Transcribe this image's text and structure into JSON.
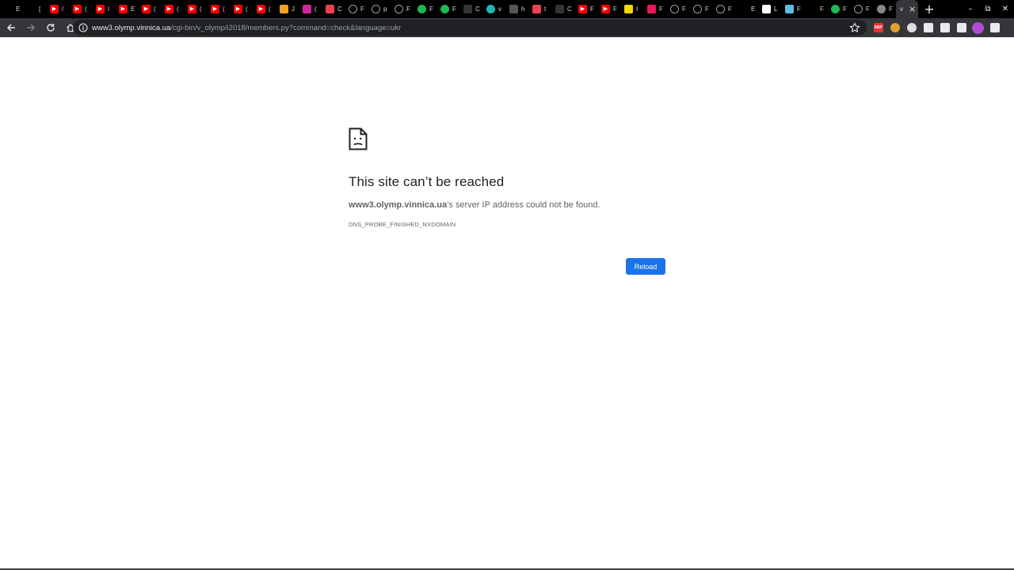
{
  "browser": {
    "tabs": [
      {
        "title": "E",
        "icon": "blank-icon",
        "color": "#000000"
      },
      {
        "title": "[",
        "icon": "blank-icon",
        "color": "#000000"
      },
      {
        "title": "/",
        "icon": "youtube-icon",
        "color": "#ff0000"
      },
      {
        "title": "(",
        "icon": "youtube-icon",
        "color": "#ff0000"
      },
      {
        "title": "I",
        "icon": "youtube-icon",
        "color": "#ff0000"
      },
      {
        "title": "E",
        "icon": "youtube-icon",
        "color": "#ff0000"
      },
      {
        "title": "(",
        "icon": "youtube-icon",
        "color": "#ff0000"
      },
      {
        "title": "(",
        "icon": "youtube-icon",
        "color": "#ff0000"
      },
      {
        "title": "(",
        "icon": "youtube-icon",
        "color": "#ff0000"
      },
      {
        "title": "(",
        "icon": "youtube-icon",
        "color": "#ff0000"
      },
      {
        "title": "(",
        "icon": "youtube-icon",
        "color": "#ff0000"
      },
      {
        "title": "(",
        "icon": "youtube-icon",
        "color": "#ff0000"
      },
      {
        "title": "J",
        "icon": "kaggle-icon",
        "color": "#f4a020"
      },
      {
        "title": "(",
        "icon": "instagram-icon",
        "color": "#d6249f"
      },
      {
        "title": "C",
        "icon": "pocket-icon",
        "color": "#ef4056"
      },
      {
        "title": "F",
        "icon": "github-icon",
        "color": "#24292e"
      },
      {
        "title": "p",
        "icon": "github-icon",
        "color": "#24292e"
      },
      {
        "title": "F",
        "icon": "github-icon",
        "color": "#24292e"
      },
      {
        "title": "F",
        "icon": "spotify-icon",
        "color": "#1db954"
      },
      {
        "title": "F",
        "icon": "spotify-icon",
        "color": "#1db954"
      },
      {
        "title": "C",
        "icon": "medium-icon",
        "color": "#333333"
      },
      {
        "title": "v",
        "icon": "teal-circle-icon",
        "color": "#1fb5b5"
      },
      {
        "title": "h",
        "icon": "grid-icon",
        "color": "#555555"
      },
      {
        "title": "t",
        "icon": "pocket-icon",
        "color": "#ef4056"
      },
      {
        "title": "C",
        "icon": "medium-icon",
        "color": "#333333"
      },
      {
        "title": "F",
        "icon": "youtube-icon",
        "color": "#ff0000"
      },
      {
        "title": "F",
        "icon": "youtube-icon",
        "color": "#ff0000"
      },
      {
        "title": "I",
        "icon": "tj-icon",
        "color": "#f5d800"
      },
      {
        "title": "F",
        "icon": "hexagon-icon",
        "color": "#e8175d"
      },
      {
        "title": "F",
        "icon": "github-icon",
        "color": "#24292e"
      },
      {
        "title": "F",
        "icon": "github-icon",
        "color": "#24292e"
      },
      {
        "title": "F",
        "icon": "github-icon",
        "color": "#24292e"
      },
      {
        "title": "E",
        "icon": "eb-icon",
        "color": "#000000"
      },
      {
        "title": "L",
        "icon": "notion-icon",
        "color": "#ffffff"
      },
      {
        "title": "F",
        "icon": "ms-tile-icon",
        "color": "#5bc0de"
      },
      {
        "title": "F",
        "icon": "cross-icon",
        "color": "#000000"
      },
      {
        "title": "F",
        "icon": "spotify-icon",
        "color": "#1db954"
      },
      {
        "title": "F",
        "icon": "github-icon",
        "color": "#24292e"
      },
      {
        "title": "F",
        "icon": "globe-icon",
        "color": "#888888"
      }
    ],
    "active_tab": {
      "title": "v",
      "close": "×"
    },
    "new_tab": "+",
    "window_controls": {
      "minimize": "–",
      "restore": "⧉",
      "close": "✕"
    },
    "url_host": "www3.olymp.vinnica.ua",
    "url_path": "/cgi-bin/v_olymp/i2018/members.py?command=check&language=ukr",
    "extensions": [
      {
        "name": "adblock-icon",
        "label": "ABP",
        "color": "#e8322f"
      },
      {
        "name": "cookie-icon",
        "label": "",
        "color": "#e0a030"
      },
      {
        "name": "grammarly-icon",
        "label": "",
        "color": "#dddddd"
      },
      {
        "name": "grid-ext-icon",
        "label": "",
        "color": "#e8eaed"
      },
      {
        "name": "github-ext-icon",
        "label": "",
        "color": "#e8eaed"
      },
      {
        "name": "playlist-icon",
        "label": "",
        "color": "#e8eaed"
      },
      {
        "name": "profile-avatar",
        "label": "",
        "color": "#b04ad0"
      },
      {
        "name": "menu-icon",
        "label": "",
        "color": "#e8eaed"
      }
    ]
  },
  "error": {
    "title": "This site can’t be reached",
    "host": "www3.olymp.vinnica.ua",
    "message": "’s server IP address could not be found.",
    "code": "DNS_PROBE_FINISHED_NXDOMAIN",
    "reload_label": "Reload"
  },
  "colors": {
    "accent": "#1a73e8",
    "toolbar": "#35363a",
    "tabstrip": "#000000",
    "omnibox": "#202124"
  }
}
